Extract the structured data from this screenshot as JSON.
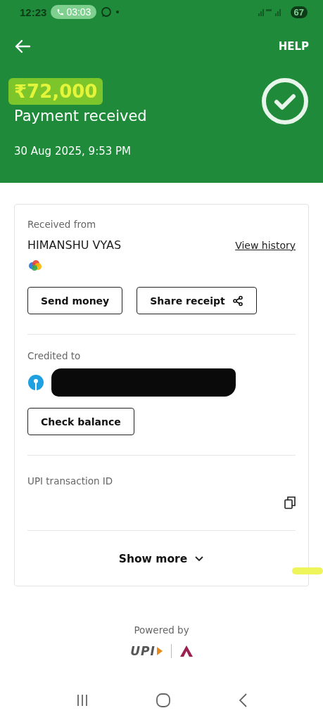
{
  "status_bar": {
    "time": "12:23",
    "call_timer": "03:03",
    "battery": "67"
  },
  "header": {
    "help": "HELP",
    "amount": "₹72,000",
    "amount_highlighted": true,
    "title": "Payment received",
    "datetime": "30 Aug 2025, 9:53 PM"
  },
  "sender": {
    "label": "Received from",
    "name": "HIMANSHU VYAS",
    "link": "View history",
    "buttons": [
      {
        "label": "Send money",
        "kind": "plain"
      },
      {
        "label": "Share receipt",
        "kind": "share"
      }
    ]
  },
  "credited": {
    "label": "Credited to",
    "account_redacted": true,
    "button": "Check balance"
  },
  "transaction": {
    "label": "UPI transaction ID"
  },
  "show_more": "Show more",
  "footer": {
    "powered_by": "Powered by",
    "logo": "UPI"
  }
}
